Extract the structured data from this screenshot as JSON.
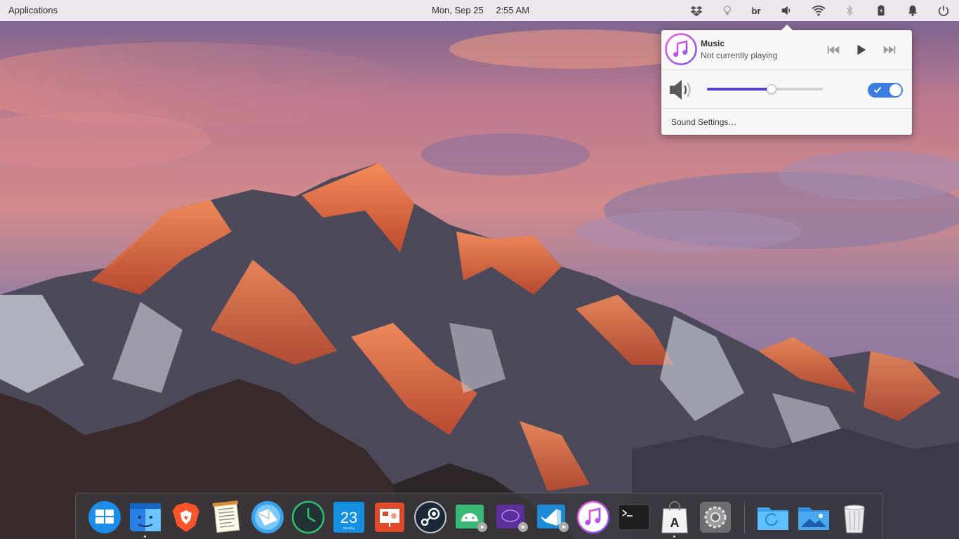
{
  "top_panel": {
    "applications_label": "Applications",
    "date": "Mon, Sep 25",
    "time": "2:55 AM",
    "keyboard_layout": "br",
    "tray_icons": [
      "dropbox-icon",
      "caffeine-icon",
      "keyboard-layout",
      "volume-icon",
      "wifi-icon",
      "bluetooth-icon",
      "battery-icon",
      "notifications-icon",
      "power-icon"
    ]
  },
  "sound_popover": {
    "player": {
      "app_name": "Music",
      "status": "Not currently playing",
      "controls": [
        "previous-icon",
        "play-icon",
        "next-icon"
      ]
    },
    "volume": {
      "level": 0.56,
      "enabled": true
    },
    "settings_link": "Sound Settings…"
  },
  "dock": {
    "items": [
      {
        "name": "multitasking-view",
        "running": false
      },
      {
        "name": "finder",
        "running": true
      },
      {
        "name": "brave-browser",
        "running": false
      },
      {
        "name": "text-editor",
        "running": false
      },
      {
        "name": "mail",
        "running": false
      },
      {
        "name": "clock",
        "running": false
      },
      {
        "name": "calendar",
        "running": false,
        "day": "23",
        "weekday": "Monday"
      },
      {
        "name": "presentation",
        "running": false
      },
      {
        "name": "steam",
        "running": false
      },
      {
        "name": "android-studio",
        "running": false
      },
      {
        "name": "video-player",
        "running": false
      },
      {
        "name": "visual-studio-code",
        "running": false
      },
      {
        "name": "music",
        "running": false
      },
      {
        "name": "terminal",
        "running": false
      },
      {
        "name": "app-store",
        "running": true
      },
      {
        "name": "system-settings",
        "running": false
      },
      {
        "name": "downloads-folder",
        "running": false
      },
      {
        "name": "image-viewer",
        "running": false
      },
      {
        "name": "trash",
        "running": false
      }
    ]
  },
  "colors": {
    "accent": "#4f3fd6",
    "switch": "#3b7de0",
    "panel": "#f6f0f6",
    "dock": "#3a383e"
  }
}
